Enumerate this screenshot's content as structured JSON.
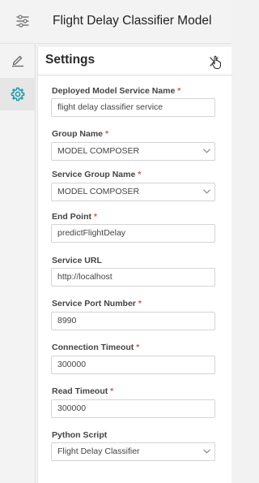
{
  "header": {
    "title": "Flight Delay Classifier Model",
    "menu_icon": "sliders-icon"
  },
  "sidebar": {
    "items": [
      {
        "icon": "pencil-icon",
        "active": false
      },
      {
        "icon": "gear-icon",
        "active": true
      }
    ]
  },
  "settings": {
    "title": "Settings",
    "close_icon": "close-icon",
    "fields": [
      {
        "label": "Deployed Model Service Name",
        "required": "*",
        "value": "flight delay classifier service",
        "type": "text"
      },
      {
        "label": "Group Name",
        "required": "*",
        "value": "MODEL COMPOSER",
        "type": "select"
      },
      {
        "label": "Service Group Name",
        "required": "*",
        "value": "MODEL COMPOSER",
        "type": "select"
      },
      {
        "label": "End Point",
        "required": "*",
        "value": "predictFlightDelay",
        "type": "text"
      },
      {
        "label": "Service URL",
        "required": "",
        "value": "http://localhost",
        "type": "text"
      },
      {
        "label": "Service Port Number",
        "required": "*",
        "value": "8990",
        "type": "text"
      },
      {
        "label": "Connection Timeout",
        "required": "*",
        "value": "300000",
        "type": "text"
      },
      {
        "label": "Read Timeout",
        "required": "*",
        "value": "300000",
        "type": "text"
      },
      {
        "label": "Python Script",
        "required": "",
        "value": "Flight Delay Classifier",
        "type": "select"
      }
    ]
  },
  "colors": {
    "accent": "#1a9aa8",
    "required": "#d9534f"
  }
}
